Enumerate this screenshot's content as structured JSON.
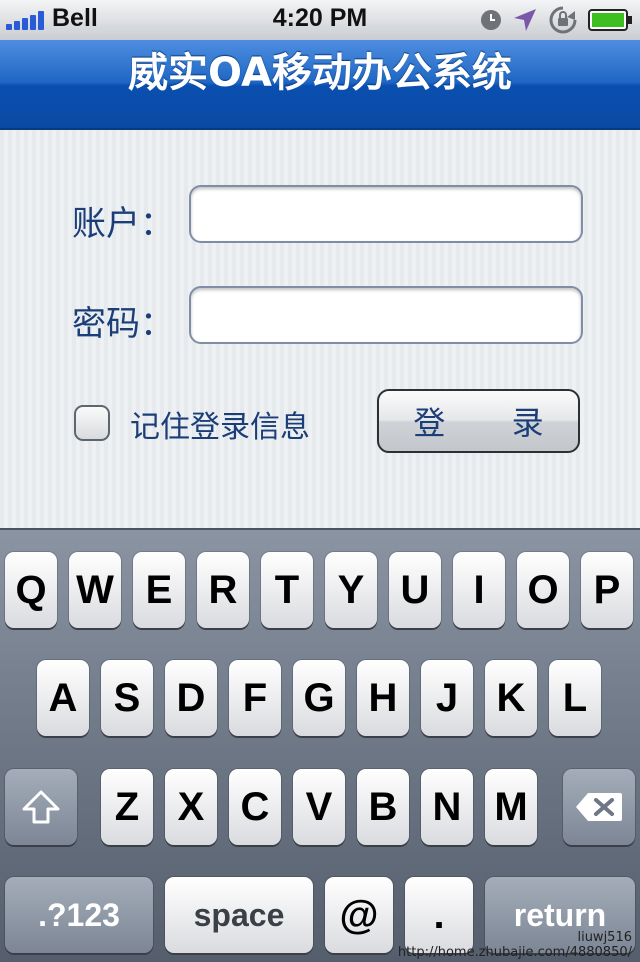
{
  "status_bar": {
    "carrier": "Bell",
    "time": "4:20 PM",
    "signal_color": "#2a5bd7",
    "battery_color": "#3cbf1f"
  },
  "nav": {
    "title": "威实OA移动办公系统",
    "color": "#1f67c4"
  },
  "form": {
    "account_label": "账户：",
    "account_value": "",
    "password_label": "密码：",
    "password_value": "",
    "remember_label": "记住登录信息",
    "remember_checked": false,
    "login_label": "登 录"
  },
  "keyboard": {
    "row1": [
      "Q",
      "W",
      "E",
      "R",
      "T",
      "Y",
      "U",
      "I",
      "O",
      "P"
    ],
    "row2": [
      "A",
      "S",
      "D",
      "F",
      "G",
      "H",
      "J",
      "K",
      "L"
    ],
    "row3": [
      "Z",
      "X",
      "C",
      "V",
      "B",
      "N",
      "M"
    ],
    "shift_icon": "shift-arrow-icon",
    "delete_icon": "backspace-icon",
    "numbers_label": ".?123",
    "space_label": "space",
    "at_label": "@",
    "dot_label": ".",
    "return_label": "return"
  },
  "watermark": {
    "user": "liuwj516",
    "url": "http://home.zhubajie.com/4880850/"
  }
}
